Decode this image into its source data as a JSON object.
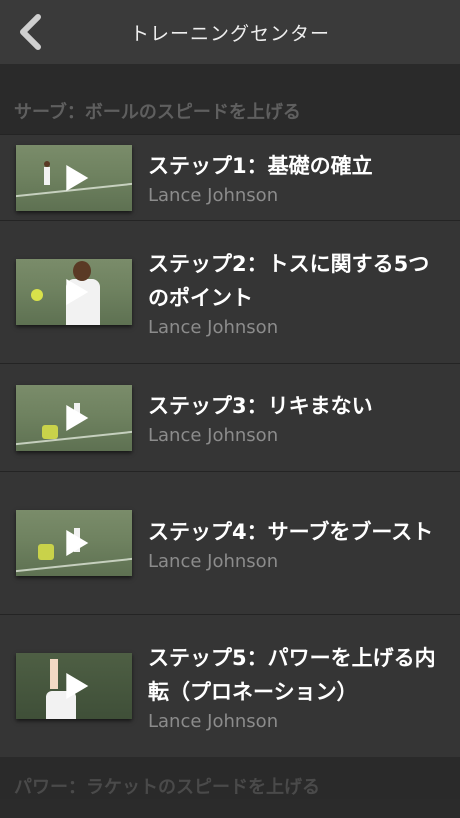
{
  "header": {
    "title": "トレーニングセンター"
  },
  "section": {
    "title": "サーブ：ボールのスピードを上げる"
  },
  "videos": [
    {
      "title": "ステップ1：基礎の確立",
      "author": "Lance Johnson"
    },
    {
      "title": "ステップ2：トスに関する5つのポイント",
      "author": "Lance Johnson"
    },
    {
      "title": "ステップ3：リキまない",
      "author": "Lance Johnson"
    },
    {
      "title": "ステップ4：サーブをブースト",
      "author": "Lance Johnson"
    },
    {
      "title": "ステップ5：パワーを上げる内転（プロネーション）",
      "author": "Lance Johnson"
    }
  ],
  "next_section": {
    "title": "パワー：ラケットのスピードを上げる"
  },
  "colors": {
    "nav": "#3a3a3a",
    "row": "#353535",
    "bg": "#2b2b2b"
  }
}
